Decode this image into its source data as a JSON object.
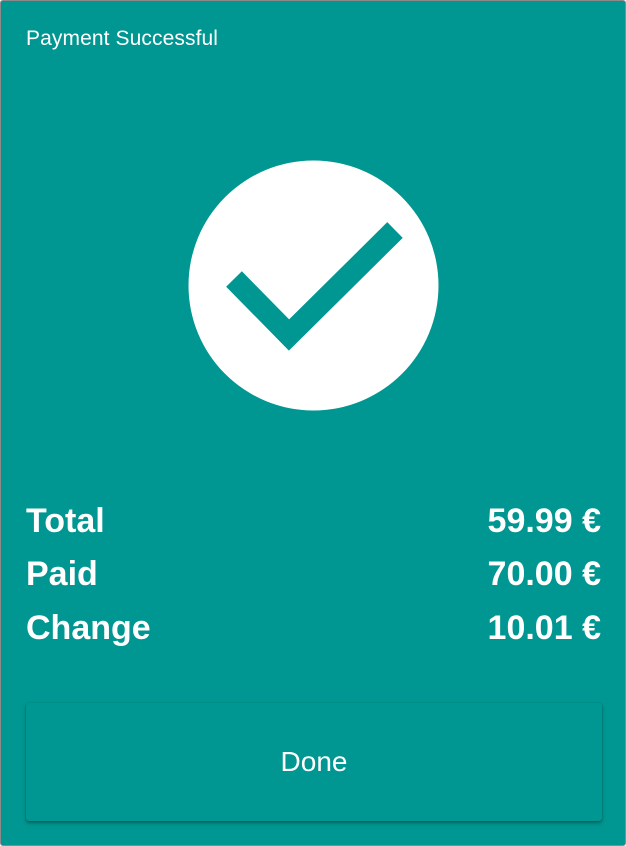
{
  "dialog": {
    "title": "Payment Successful",
    "background_color": "#009691",
    "icon": "check-circle-icon"
  },
  "summary": {
    "rows": [
      {
        "label": "Total",
        "value": "59.99 €"
      },
      {
        "label": "Paid",
        "value": "70.00 €"
      },
      {
        "label": "Change",
        "value": "10.01 €"
      }
    ]
  },
  "actions": {
    "done_label": "Done"
  }
}
